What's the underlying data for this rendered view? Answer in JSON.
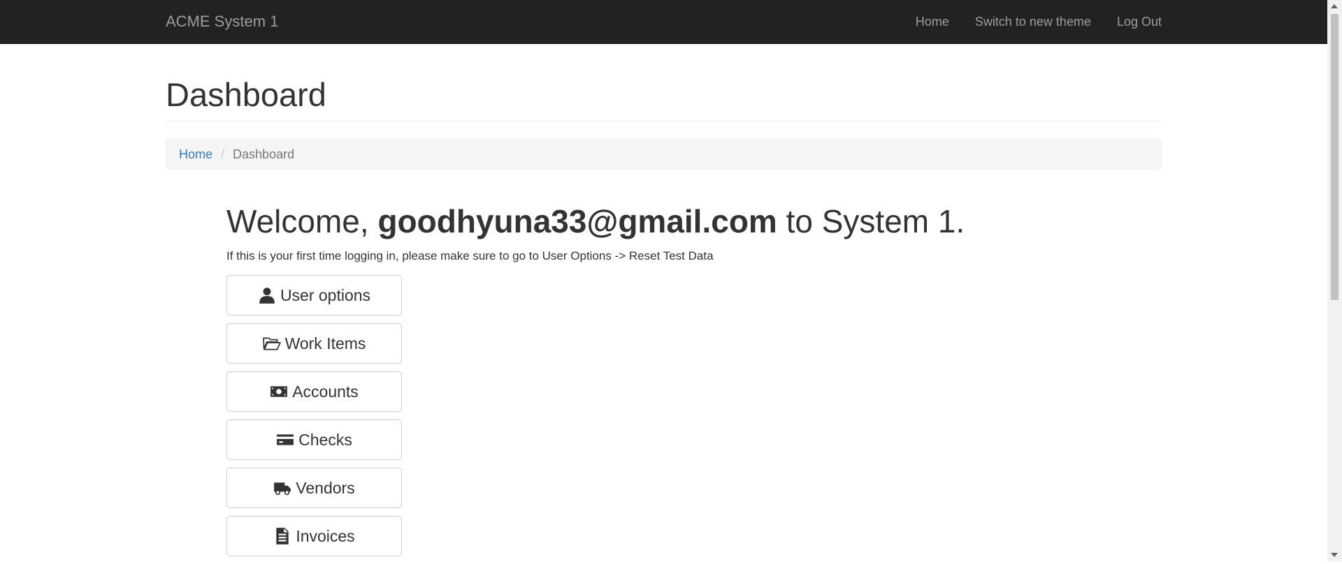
{
  "navbar": {
    "brand": "ACME System 1",
    "links": [
      "Home",
      "Switch to new theme",
      "Log Out"
    ]
  },
  "page": {
    "title": "Dashboard"
  },
  "breadcrumb": {
    "home": "Home",
    "separator": "/",
    "current": "Dashboard"
  },
  "welcome": {
    "prefix": "Welcome,",
    "user": "goodhyuna33@gmail.com",
    "suffix": "to System 1.",
    "hint": "If this is your first time logging in, please make sure to go to User Options -> Reset Test Data"
  },
  "menu": [
    {
      "label": "User options",
      "icon": "user-icon"
    },
    {
      "label": "Work Items",
      "icon": "folder-open-icon"
    },
    {
      "label": "Accounts",
      "icon": "money-icon"
    },
    {
      "label": "Checks",
      "icon": "credit-card-icon"
    },
    {
      "label": "Vendors",
      "icon": "truck-icon"
    },
    {
      "label": "Invoices",
      "icon": "file-text-icon"
    }
  ],
  "colors": {
    "navbar_bg": "#222222",
    "nav_text": "#9d9d9d",
    "link": "#337ab7",
    "breadcrumb_bg": "#f5f5f5"
  }
}
